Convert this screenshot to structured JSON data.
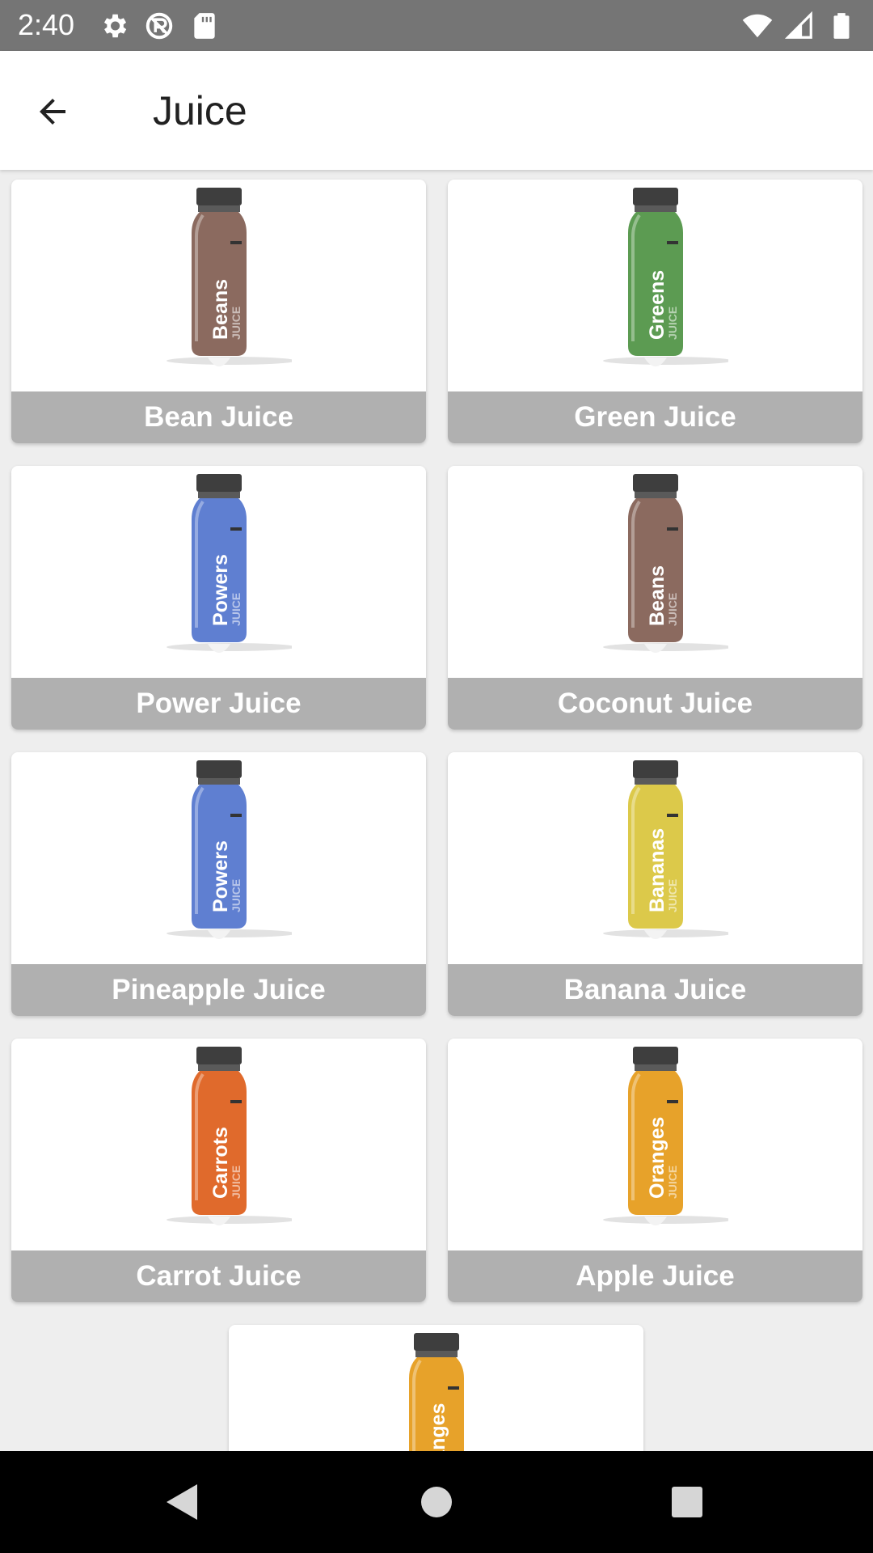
{
  "status_bar": {
    "time": "2:40",
    "left_icons": [
      "settings-icon",
      "no-sync-icon",
      "sd-card-icon"
    ],
    "right_icons": [
      "wifi-icon",
      "signal-icon",
      "battery-icon"
    ]
  },
  "app_bar": {
    "title": "Juice",
    "back_icon": "arrow-back-icon"
  },
  "products": [
    {
      "name": "Bean Juice",
      "bottle_text": "Beans",
      "color": "#8b6a5f"
    },
    {
      "name": "Green Juice",
      "bottle_text": "Greens",
      "color": "#5c9b52"
    },
    {
      "name": "Power Juice",
      "bottle_text": "Powers",
      "color": "#5f7fd1"
    },
    {
      "name": "Coconut Juice",
      "bottle_text": "Beans",
      "color": "#8b6a5f"
    },
    {
      "name": "Pineapple Juice",
      "bottle_text": "Powers",
      "color": "#5f7fd1"
    },
    {
      "name": "Banana Juice",
      "bottle_text": "Bananas",
      "color": "#dcc94a"
    },
    {
      "name": "Carrot Juice",
      "bottle_text": "Carrots",
      "color": "#e06a2c"
    },
    {
      "name": "Apple Juice",
      "bottle_text": "Oranges",
      "color": "#e7a22a"
    },
    {
      "name": "",
      "bottle_text": "Oranges",
      "color": "#e7a22a"
    }
  ],
  "bottle_sub_text": "JUICE",
  "nav_bar": {
    "buttons": [
      "back-triangle-icon",
      "home-circle-icon",
      "recents-square-icon"
    ]
  }
}
